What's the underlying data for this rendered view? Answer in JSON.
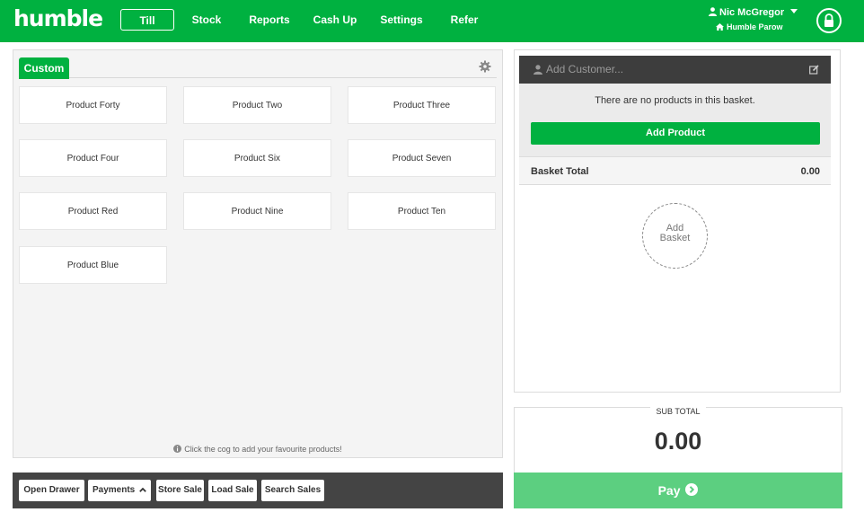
{
  "app": {
    "logo": "humble"
  },
  "nav": {
    "items": [
      {
        "label": "Till",
        "active": true
      },
      {
        "label": "Stock"
      },
      {
        "label": "Reports"
      },
      {
        "label": "Cash Up"
      },
      {
        "label": "Settings"
      },
      {
        "label": "Refer"
      }
    ],
    "user_name": "Nic McGregor",
    "store_name": "Humble Parow"
  },
  "products": {
    "tab_label": "Custom",
    "items": [
      "Product Forty",
      "Product Two",
      "Product Three",
      "Product Four",
      "Product Six",
      "Product Seven",
      "Product Red",
      "Product Nine",
      "Product Ten",
      "Product Blue"
    ],
    "hint": "Click the cog to add your favourite products!"
  },
  "toolbar": {
    "buttons": [
      "Open Drawer",
      "Payments",
      "Store Sale",
      "Load Sale",
      "Search Sales"
    ]
  },
  "basket": {
    "customer_placeholder": "Add Customer...",
    "empty_message": "There are no products in this basket.",
    "add_product_label": "Add Product",
    "total_label": "Basket Total",
    "total_value": "0.00",
    "add_basket_line1": "Add",
    "add_basket_line2": "Basket"
  },
  "checkout": {
    "subtotal_label": "SUB TOTAL",
    "subtotal_value": "0.00",
    "pay_label": "Pay"
  },
  "colors": {
    "brand_green": "#00b140",
    "pay_green": "#5ccf80",
    "dark_bar": "#3d3d3d"
  }
}
